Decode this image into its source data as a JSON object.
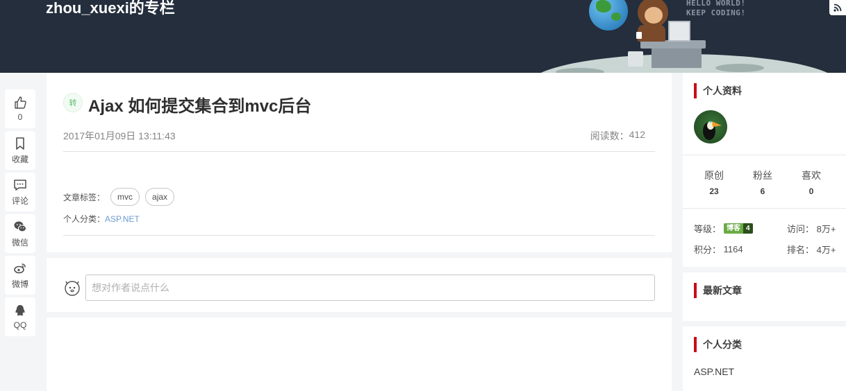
{
  "header": {
    "blog_title": "zhou_xuexi的专栏",
    "banner_text_line1": "HELLO WORLD!",
    "banner_text_line2": "KEEP CODING!",
    "rss_icon": "rss-icon"
  },
  "share": {
    "like_count": "0",
    "favorite_label": "收藏",
    "comment_label": "评论",
    "wechat_label": "微信",
    "weibo_label": "微博",
    "qq_label": "QQ"
  },
  "article": {
    "type_badge": "转",
    "title": "Ajax 如何提交集合到mvc后台",
    "date": "2017年01月09日 13:11:43",
    "read_label": "阅读数：",
    "read_count": "412",
    "tags_label": "文章标签：",
    "tags": [
      "mvc",
      "ajax"
    ],
    "category_label": "个人分类：",
    "category": "ASP.NET"
  },
  "comment": {
    "placeholder": "想对作者说点什么"
  },
  "profile": {
    "heading": "个人资料",
    "stats": [
      {
        "label": "原创",
        "value": "23"
      },
      {
        "label": "粉丝",
        "value": "6"
      },
      {
        "label": "喜欢",
        "value": "0"
      }
    ],
    "level_label": "等级：",
    "level_badge_text": "博客",
    "level_badge_num": "4",
    "visits_label": "访问：",
    "visits_value": "8万+",
    "points_label": "积分：",
    "points_value": "1164",
    "rank_label": "排名：",
    "rank_value": "4万+"
  },
  "latest": {
    "heading": "最新文章"
  },
  "categories": {
    "heading": "个人分类",
    "items": [
      "ASP.NET"
    ]
  },
  "colors": {
    "banner_bg": "#242e3c",
    "accent_red": "#ca0c16",
    "link_blue": "#6b9bd1",
    "badge_green": "#6aab45"
  }
}
